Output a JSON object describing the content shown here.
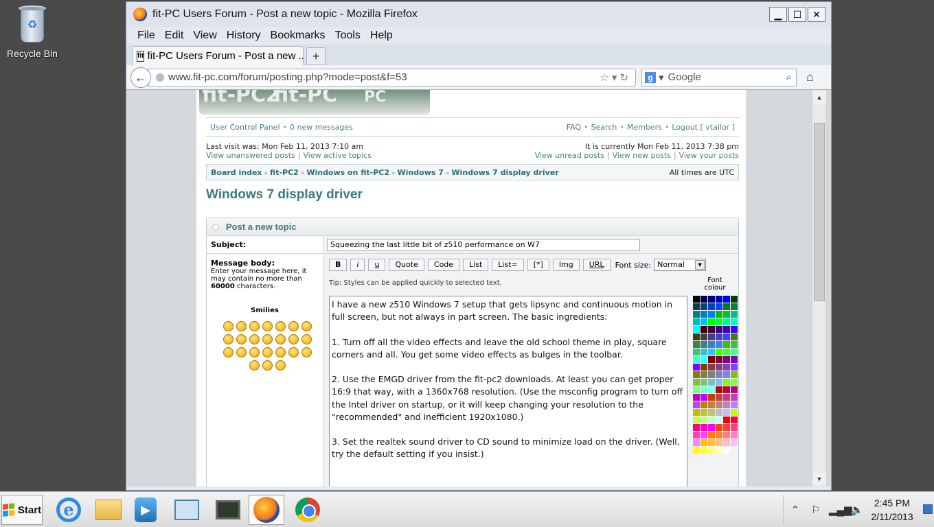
{
  "desktop": {
    "recycle_bin_label": "Recycle Bin"
  },
  "window": {
    "title": "fit-PC Users Forum - Post a new topic - Mozilla Firefox",
    "menu": [
      "File",
      "Edit",
      "View",
      "History",
      "Bookmarks",
      "Tools",
      "Help"
    ],
    "tab_title": "fit-PC Users Forum - Post a new ...",
    "new_tab": "+",
    "url": "www.fit-pc.com/forum/posting.php?mode=post&f=53",
    "search_placeholder": "Google"
  },
  "forum": {
    "banner_text": "fit-PC2  fit-PC  PC",
    "nav_left": {
      "ucp": "User Control Panel",
      "messages": "0 new messages"
    },
    "nav_right": {
      "faq": "FAQ",
      "search": "Search",
      "members": "Members",
      "logout": "Logout [ vtailor ]"
    },
    "last_visit": "Last visit was: Mon Feb 11, 2013 7:10 am",
    "unanswered": "View unanswered posts",
    "active": "View active topics",
    "current_time": "It is currently Mon Feb 11, 2013 7:38 pm",
    "unread": "View unread posts",
    "new_posts": "View new posts",
    "your_posts": "View your posts",
    "breadcrumb": [
      "Board index",
      "fit-PC2",
      "Windows on fit-PC2",
      "Windows 7",
      "Windows 7 display driver"
    ],
    "timezone": "All times are UTC",
    "topic_title": "Windows 7 display driver",
    "panel_title": "Post a new topic",
    "subject_label": "Subject:",
    "subject_value": "Squeezing the last little bit of z510 performance on W7",
    "body_label": "Message body:",
    "body_hint_1": "Enter your message here, it may contain no more than",
    "body_hint_count": "60000",
    "body_hint_2": "characters.",
    "smilies_label": "Smilies",
    "toolbar": [
      "B",
      "i",
      "u",
      "Quote",
      "Code",
      "List",
      "List=",
      "[*]",
      "Img",
      "URL"
    ],
    "font_size_label": "Font size:",
    "font_size_value": "Normal",
    "tip": "Tip: Styles can be applied quickly to selected text.",
    "font_colour_label": "Font colour",
    "message": "I have a new z510 Windows 7 setup that gets lipsync and continuous motion in full screen, but not always in part screen. The basic ingredients:\n\n1. Turn off all the video effects and leave the old school theme in play, square corners and all. You get some video effects as bulges in the toolbar.\n\n2. Use the EMGD driver from the fit-pc2 downloads. At least you can get proper 16:9 that way, with a 1360x768 resolution. (Use the msconfig program to turn off the Intel driver on startup, or it will keep changing your resolution to the \"recommended\" and inefficient 1920x1080.)\n\n3. Set the realtek sound driver to CD sound to minimize load on the driver. (Well, try the default setting if you insist.)"
  },
  "taskbar": {
    "start_label": "Start",
    "time": "2:45 PM",
    "date": "2/11/2013"
  },
  "colors": {
    "accent_teal": "#3e7b7b",
    "desktop_bg": "#4a4a4a",
    "page_bg": "#d5d9dd"
  }
}
